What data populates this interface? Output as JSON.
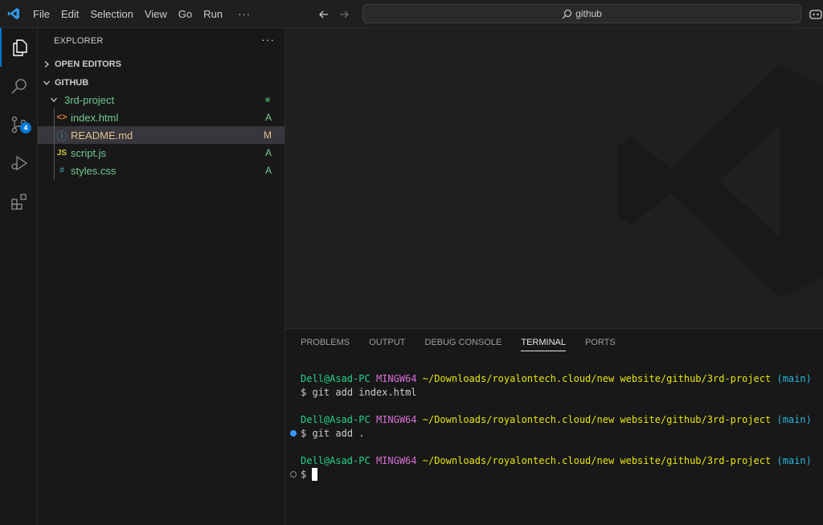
{
  "menu": [
    "File",
    "Edit",
    "Selection",
    "View",
    "Go",
    "Run"
  ],
  "menu_more": "···",
  "command_center": {
    "text": "github"
  },
  "activity_bar": {
    "items": [
      "explorer-icon",
      "search-icon",
      "source-control-icon",
      "run-debug-icon",
      "extensions-icon"
    ],
    "scm_badge": "4",
    "accent_color": "#0078d4"
  },
  "explorer": {
    "title": "EXPLORER",
    "more": "···",
    "open_editors": "OPEN EDITORS",
    "workspace": "GITHUB",
    "folder": "3rd-project",
    "files": [
      {
        "name": "index.html",
        "icon": "<>",
        "status": "A"
      },
      {
        "name": "README.md",
        "icon": "ⓘ",
        "status": "M"
      },
      {
        "name": "script.js",
        "icon": "JS",
        "status": "A"
      },
      {
        "name": "styles.css",
        "icon": "#",
        "status": "A"
      }
    ]
  },
  "panel": {
    "tabs": [
      "PROBLEMS",
      "OUTPUT",
      "DEBUG CONSOLE",
      "TERMINAL",
      "PORTS"
    ],
    "active_tab": "TERMINAL",
    "terminal": {
      "user": "Dell@Asad-PC",
      "system": "MINGW64",
      "path": "~/Downloads/royalontech.cloud/new website/github/3rd-project",
      "branch": "(main)",
      "prompt": "$",
      "commands": [
        "git add index.html",
        "git add ."
      ]
    }
  },
  "colors": {
    "added": "#73c991",
    "modified": "#e2c08d",
    "terminal_user": "#23d18b",
    "terminal_system": "#d670d6",
    "terminal_path": "#e5e510",
    "terminal_branch": "#29b8db"
  }
}
